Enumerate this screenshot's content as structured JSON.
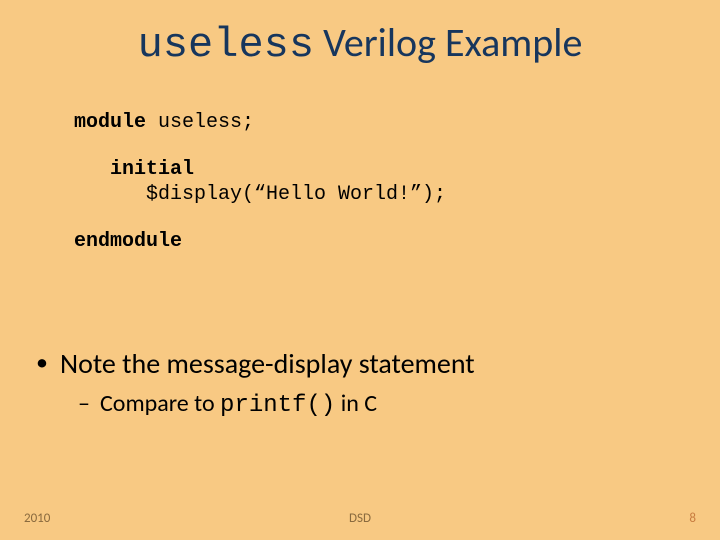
{
  "title": {
    "mono": "useless",
    "rest": " Verilog Example"
  },
  "code": {
    "module_kw": "module",
    "module_name": " useless;",
    "initial_kw": "initial",
    "display_line": "$display(“Hello World!”);",
    "endmodule_kw": "endmodule"
  },
  "bullet": {
    "main": "Note the message-display statement",
    "sub_prefix": "Compare to ",
    "sub_mono": "printf()",
    "sub_suffix": " in C"
  },
  "footer": {
    "year": "2010",
    "mid": "DSD",
    "page": "8"
  }
}
